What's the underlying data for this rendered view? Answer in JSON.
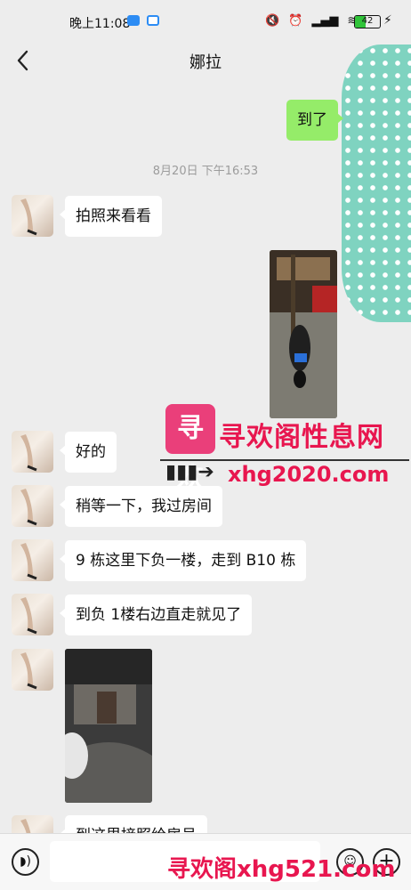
{
  "status_bar": {
    "time": "晚上11:08",
    "battery": "42",
    "icons": [
      "mute-icon",
      "alarm-icon",
      "signal-icon",
      "wifi-icon",
      "bolt-icon"
    ]
  },
  "header": {
    "title": "娜拉",
    "back_icon": "chevron-left-icon"
  },
  "messages": {
    "m1": "到了",
    "timestamp": "8月20日 下午16:53",
    "m2": "拍照来看看",
    "m3": "好的",
    "m4": "稍等一下，我过房间",
    "m5": "9 栋这里下负一楼，走到 B10 栋",
    "m6": "到负 1楼右边直走就见了",
    "m7": "到这里接照给房号"
  },
  "watermark": {
    "logo_text": "寻欢",
    "title": "寻欢阁性息网",
    "url": "xhg2020.com",
    "bottom": "寻欢阁xhg521.com"
  },
  "input_bar": {
    "placeholder": ""
  },
  "colors": {
    "sent_bubble": "#95ec69",
    "received_bubble": "#ffffff",
    "background": "#ededed",
    "watermark": "#e8164f"
  }
}
